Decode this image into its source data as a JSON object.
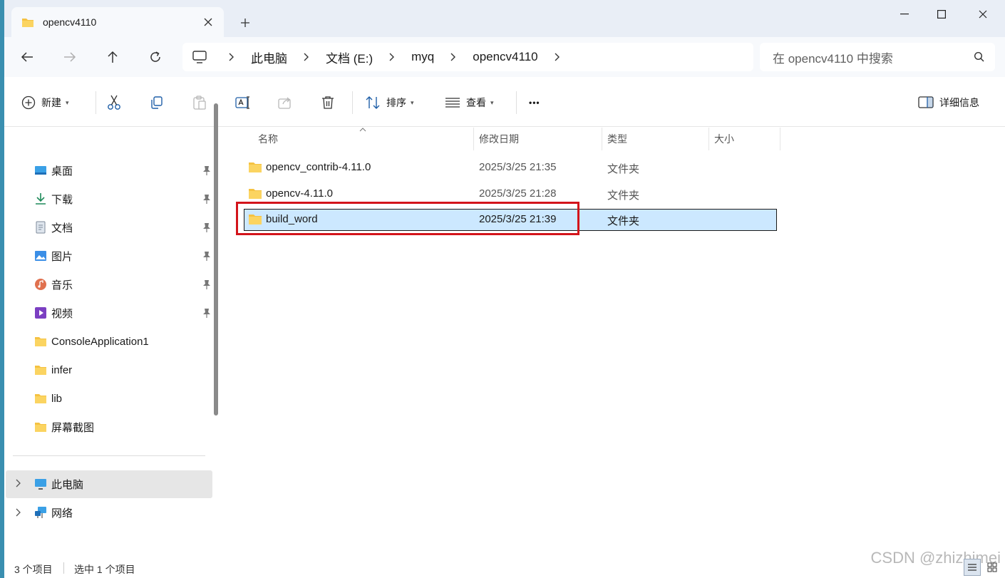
{
  "tab": {
    "title": "opencv4110"
  },
  "address": {
    "crumbs": [
      "此电脑",
      "文档 (E:)",
      "myq",
      "opencv4110"
    ]
  },
  "search": {
    "placeholder": "在 opencv4110 中搜索"
  },
  "toolbar": {
    "new_label": "新建",
    "sort_label": "排序",
    "view_label": "查看",
    "more_label": "•••",
    "details_label": "详细信息"
  },
  "sidebar": {
    "quick": [
      {
        "label": "桌面",
        "icon": "desktop-icon"
      },
      {
        "label": "下载",
        "icon": "download-icon"
      },
      {
        "label": "文档",
        "icon": "document-icon"
      },
      {
        "label": "图片",
        "icon": "picture-icon"
      },
      {
        "label": "音乐",
        "icon": "music-icon"
      },
      {
        "label": "视频",
        "icon": "video-icon"
      },
      {
        "label": "ConsoleApplication1",
        "icon": "folder-icon"
      },
      {
        "label": "infer",
        "icon": "folder-icon"
      },
      {
        "label": "lib",
        "icon": "folder-icon"
      },
      {
        "label": "屏幕截图",
        "icon": "folder-icon"
      }
    ],
    "this_pc": "此电脑",
    "network": "网络"
  },
  "columns": {
    "name": "名称",
    "modified": "修改日期",
    "type": "类型",
    "size": "大小"
  },
  "files": [
    {
      "name": "opencv_contrib-4.11.0",
      "modified": "2025/3/25 21:35",
      "type": "文件夹"
    },
    {
      "name": "opencv-4.11.0",
      "modified": "2025/3/25 21:28",
      "type": "文件夹"
    },
    {
      "name": "build_word",
      "modified": "2025/3/25 21:39",
      "type": "文件夹"
    }
  ],
  "status": {
    "count": "3 个项目",
    "selected": "选中 1 个项目"
  },
  "watermark": "CSDN @zhizhimei",
  "colors": {
    "selection": "#cce8ff",
    "highlight_box": "#d3141b",
    "titlebar": "#e9eef6",
    "folder": "#f5c242"
  }
}
